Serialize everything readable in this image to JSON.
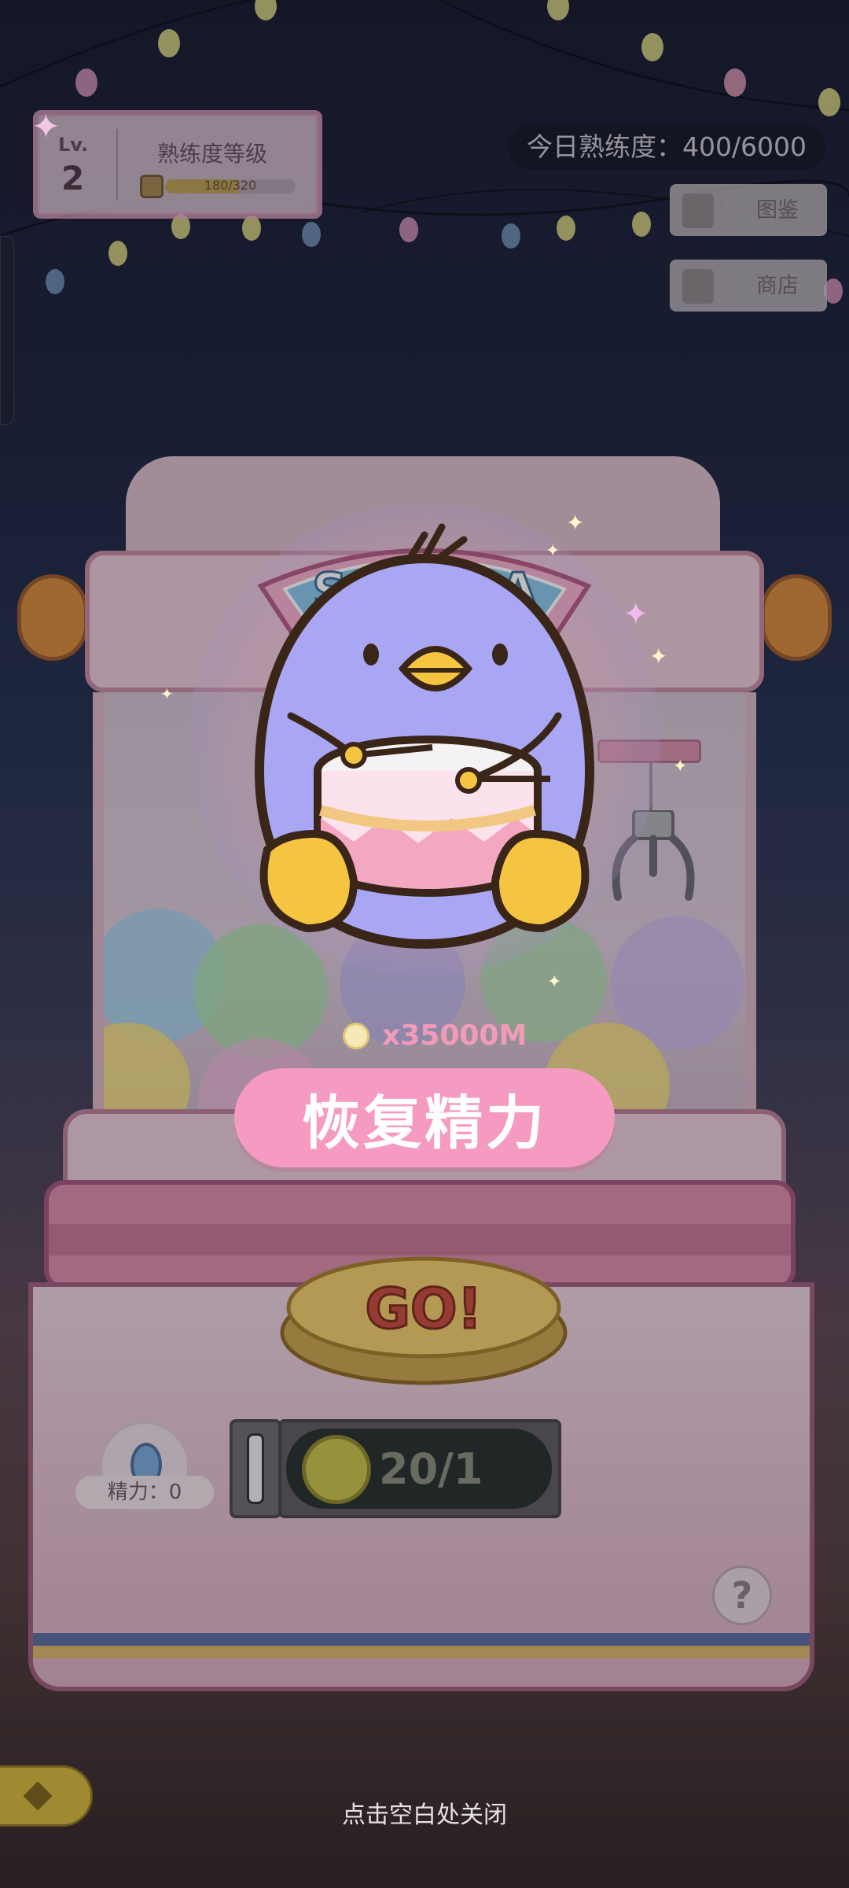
{
  "level": {
    "lv_label": "Lv.",
    "lv_number": "2",
    "title": "熟练度等级",
    "xp_text": "180/320",
    "xp_progress": 0.5625
  },
  "daily_proficiency": "今日熟练度：400/6000",
  "side_buttons": {
    "collection": "图鉴",
    "shop": "商店"
  },
  "machine": {
    "sign_text": "SAKURA",
    "go_label": "GO!"
  },
  "energy": {
    "label": "精力：0"
  },
  "coins": {
    "count": "20/1"
  },
  "help_label": "?",
  "popup": {
    "reward_text": "x35000M",
    "restore_button": "恢复精力",
    "close_hint": "点击空白处关闭"
  },
  "colors": {
    "accent_pink": "#f59ac0",
    "reward_pink": "#f29bb9",
    "penguin_purple": "#a9a6f3",
    "beak_yellow": "#f5c542"
  }
}
